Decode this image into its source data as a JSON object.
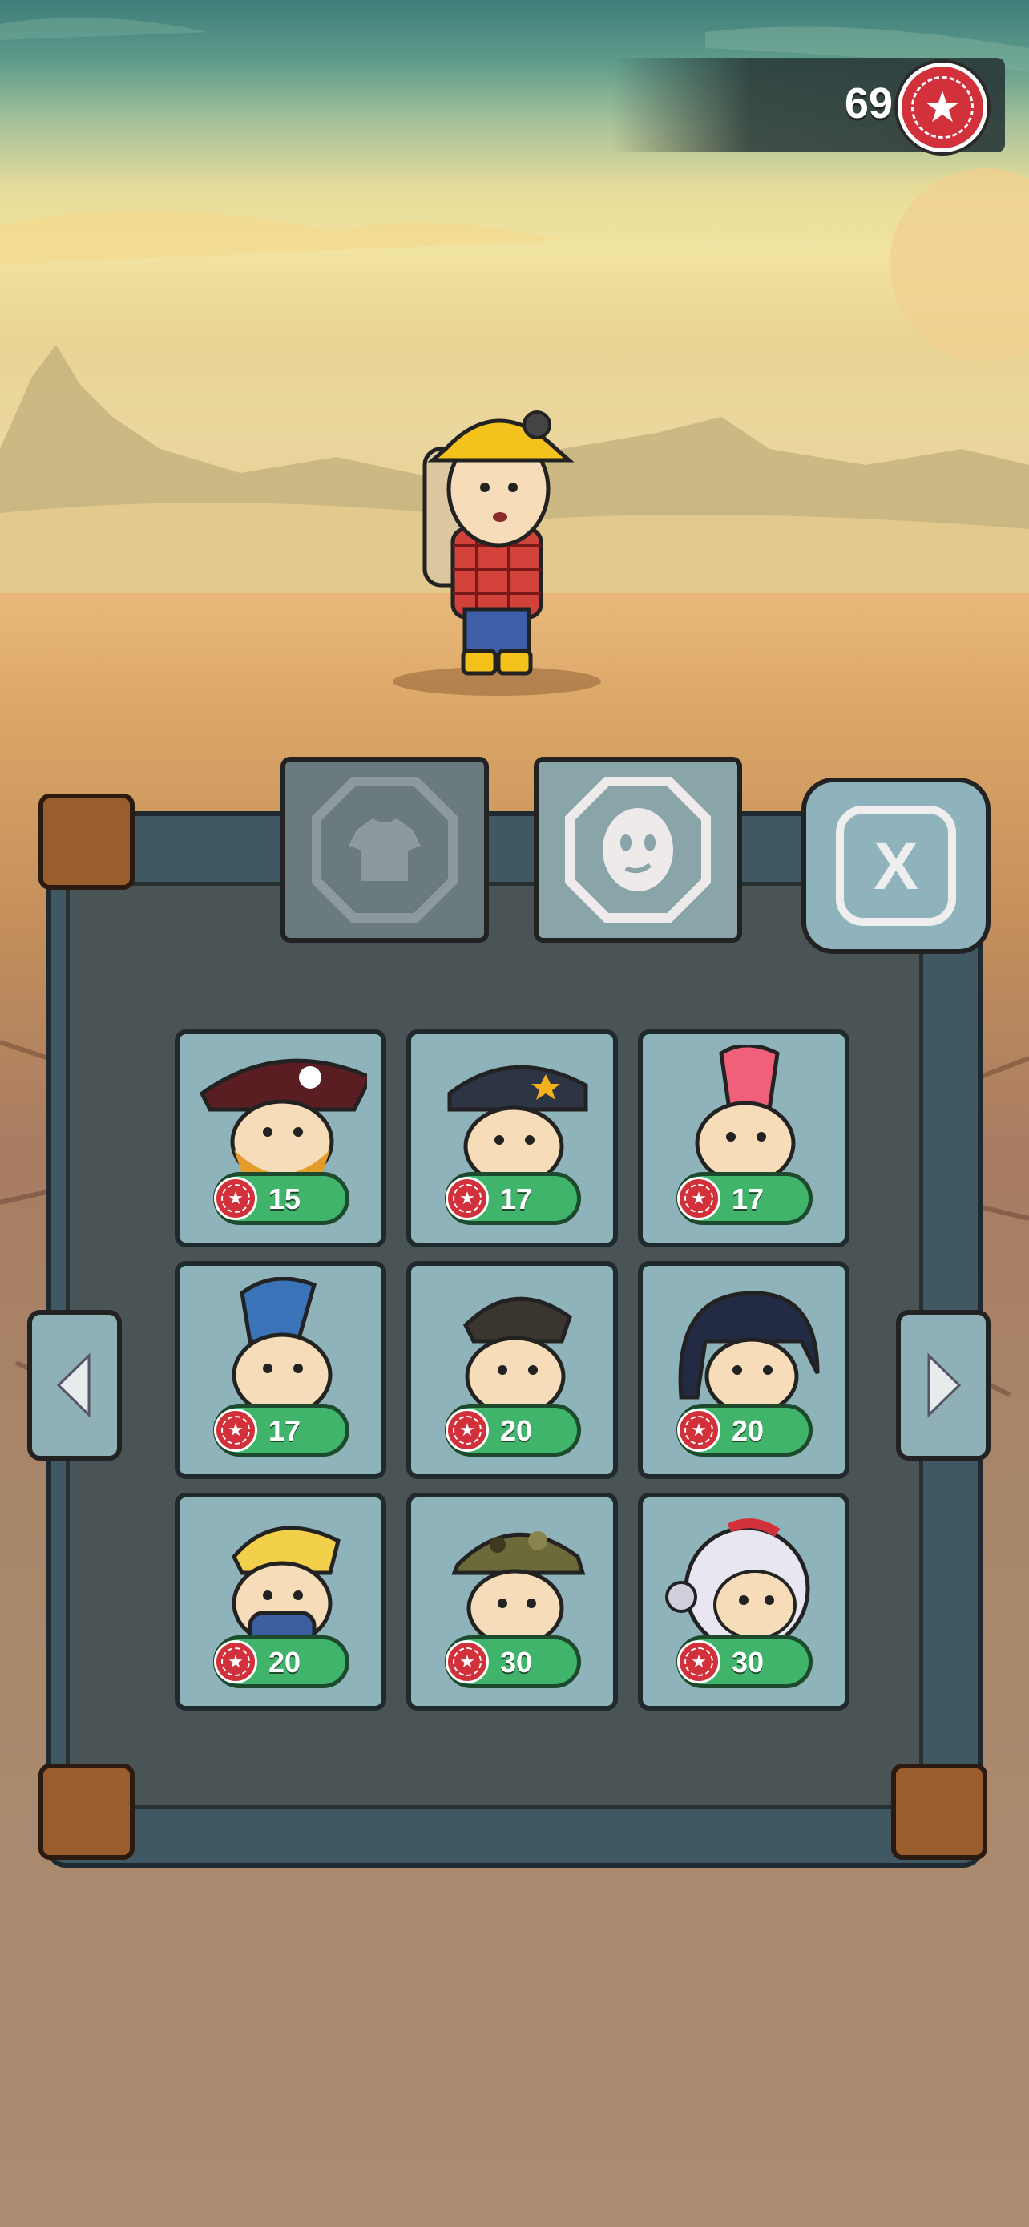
{
  "currency": {
    "amount": "69",
    "icon": "star-chip-icon"
  },
  "tabs": [
    {
      "id": "clothes",
      "icon": "shirt-icon",
      "active": false
    },
    {
      "id": "heads",
      "icon": "face-icon",
      "active": true
    }
  ],
  "close_button": {
    "label": "X"
  },
  "items": [
    {
      "name": "pirate",
      "price": "15"
    },
    {
      "name": "police",
      "price": "17"
    },
    {
      "name": "pink-mohawk",
      "price": "17"
    },
    {
      "name": "blue-mohawk",
      "price": "17"
    },
    {
      "name": "undercut",
      "price": "20"
    },
    {
      "name": "hooded-dark",
      "price": "20"
    },
    {
      "name": "gas-mask",
      "price": "20"
    },
    {
      "name": "camo-helmet",
      "price": "30"
    },
    {
      "name": "astronaut",
      "price": "30"
    }
  ],
  "colors": {
    "price_pill": "#3fb46a",
    "chip": "#d2303a",
    "card": "#8fb3ba",
    "frame": "#3f5863"
  }
}
